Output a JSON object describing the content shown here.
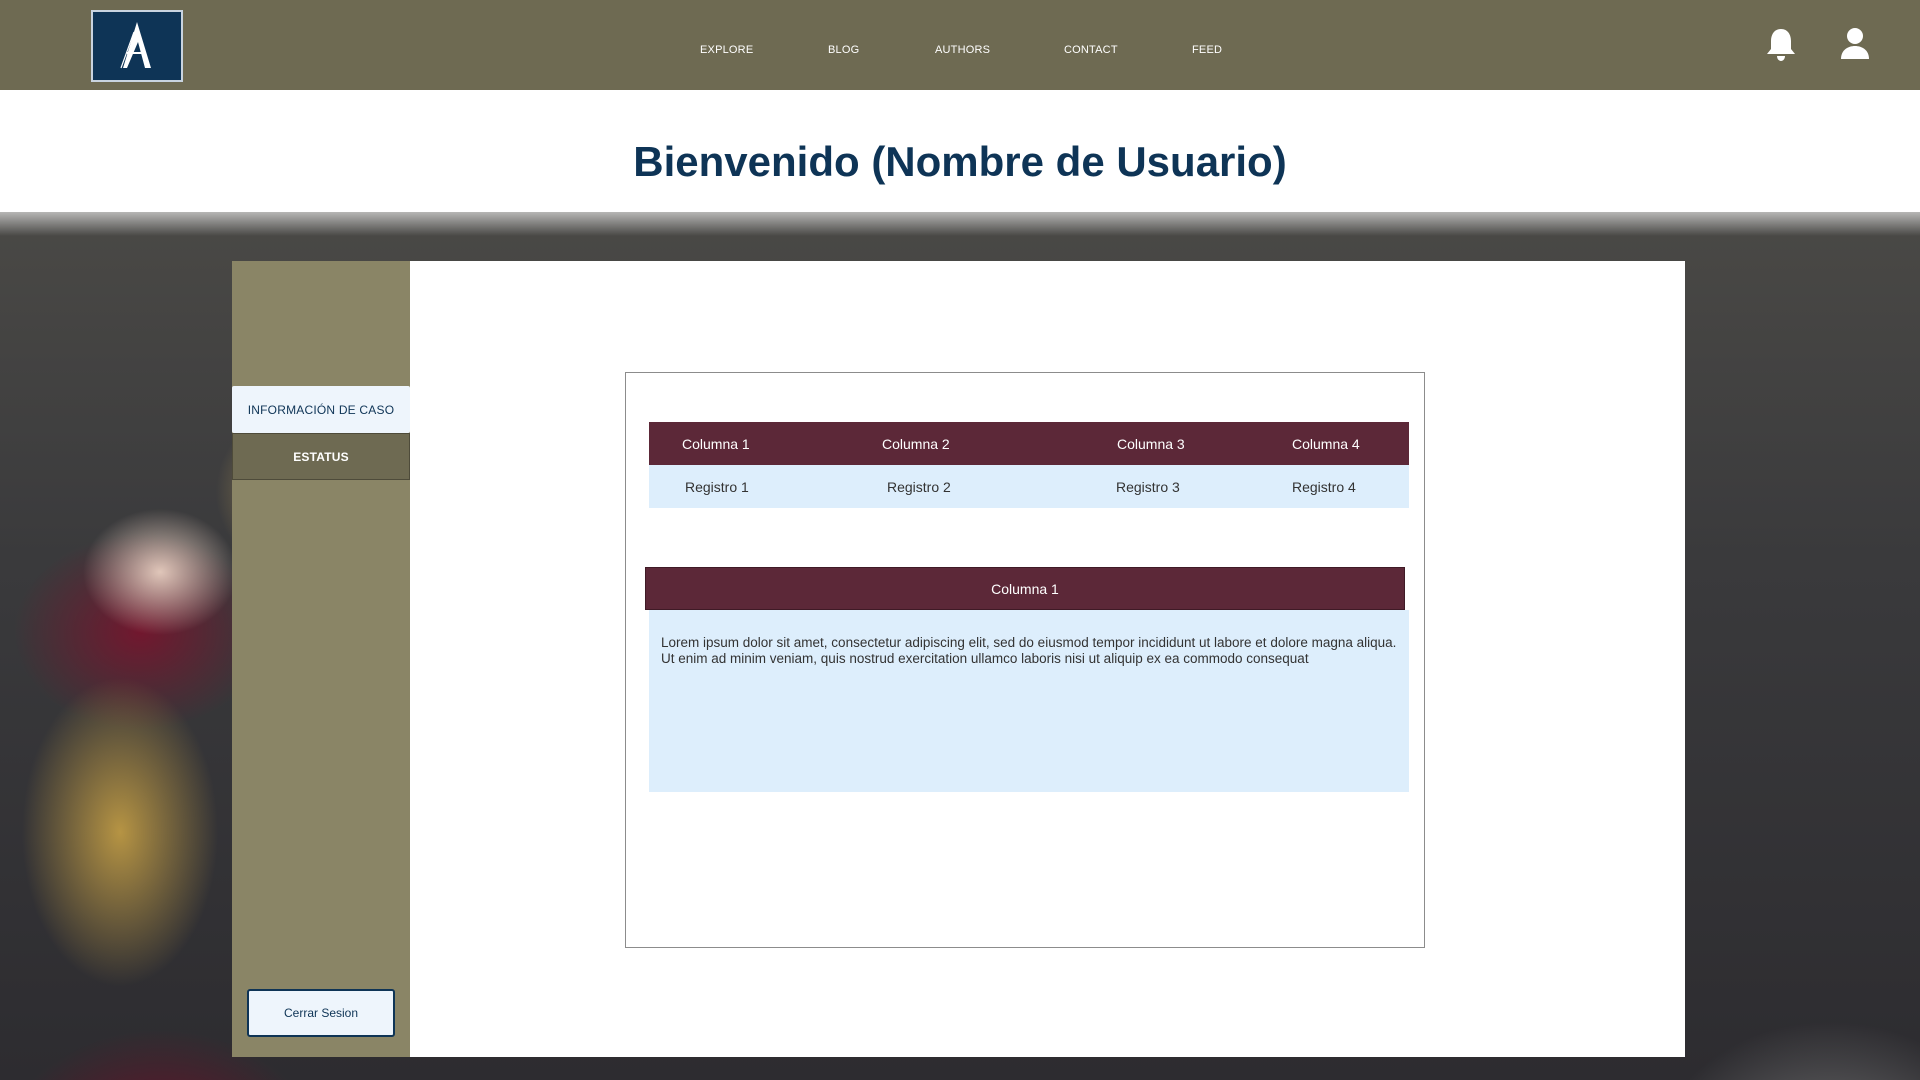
{
  "nav": {
    "links": [
      "EXPLORE",
      "BLOG",
      "AUTHORS",
      "CONTACT",
      "FEED"
    ],
    "logo_letter": "A"
  },
  "icons": {
    "notifications": "bell-icon",
    "profile": "user-icon"
  },
  "page": {
    "title": "Bienvenido (Nombre de Usuario)"
  },
  "sidebar": {
    "items": [
      {
        "label": "INFORMACIÓN DE CASO",
        "active": true
      },
      {
        "label": "ESTATUS",
        "active": false
      }
    ],
    "logout_label": "Cerrar Sesion"
  },
  "table1": {
    "headers": [
      "Columna 1",
      "Columna 2",
      "Columna 3",
      "Columna 4"
    ],
    "rows": [
      [
        "Registro 1",
        "Registro 2",
        "Registro 3",
        "Registro 4"
      ]
    ]
  },
  "table2": {
    "header": "Columna 1",
    "body": "Lorem ipsum dolor sit amet, consectetur adipiscing elit, sed do eiusmod tempor incididunt ut labore et dolore magna aliqua. Ut enim ad minim veniam, quis nostrud exercitation ullamco laboris nisi ut aliquip ex ea commodo consequat"
  },
  "colors": {
    "topbar": "#6e6a52",
    "sidebar": "#8a8566",
    "navy": "#0e3456",
    "table_header": "#5c2838",
    "table_row": "#ddeefc"
  }
}
